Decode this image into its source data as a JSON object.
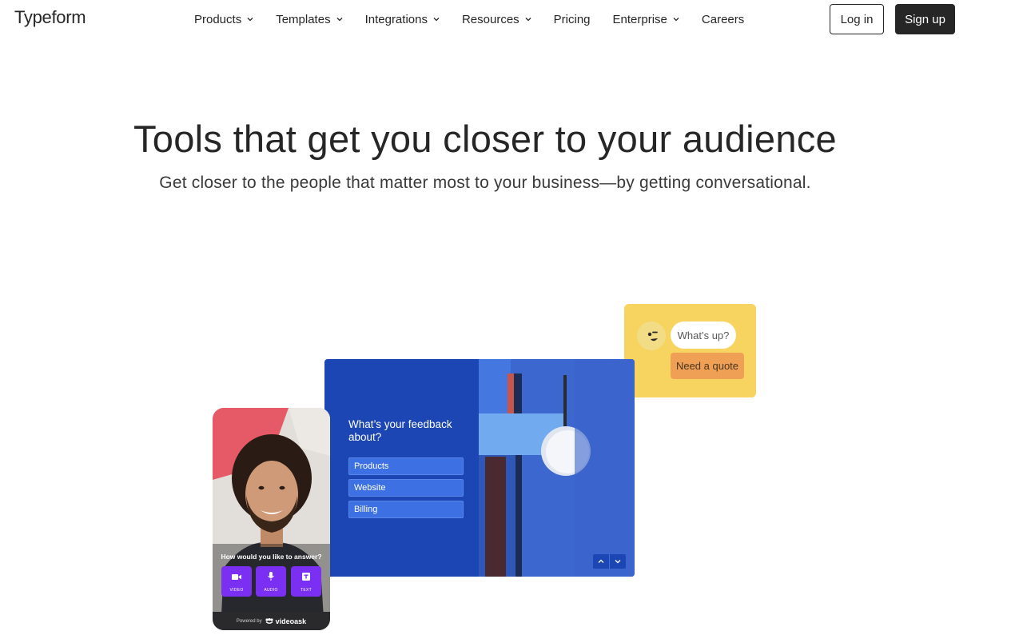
{
  "header": {
    "logo": "Typeform",
    "nav": [
      {
        "label": "Products",
        "dropdown": true
      },
      {
        "label": "Templates",
        "dropdown": true
      },
      {
        "label": "Integrations",
        "dropdown": true
      },
      {
        "label": "Resources",
        "dropdown": true
      },
      {
        "label": "Pricing",
        "dropdown": false
      },
      {
        "label": "Enterprise",
        "dropdown": true
      },
      {
        "label": "Careers",
        "dropdown": false
      }
    ],
    "login_label": "Log in",
    "signup_label": "Sign up"
  },
  "hero": {
    "title": "Tools that get you closer to your audience",
    "subtitle": "Get closer to the people that matter most to your business—by getting conversational."
  },
  "chat_card": {
    "bubble_question": "What’s up?",
    "bubble_answer": "Need a quote"
  },
  "form_card": {
    "question": "What’s your feedback about?",
    "options": [
      "Products",
      "Website",
      "Billing"
    ]
  },
  "phone_card": {
    "question": "How would you like to answer?",
    "buttons": [
      "VIDEO",
      "AUDIO",
      "TEXT"
    ],
    "powered_by": "Powered by",
    "brand": "videoask"
  },
  "colors": {
    "text": "#262627",
    "form_blue": "#1c46b3",
    "option_blue": "#3d70e3",
    "chat_yellow": "#f7d35f",
    "chat_orange": "#f0a055",
    "videoask_purple": "#7b2ff2"
  }
}
